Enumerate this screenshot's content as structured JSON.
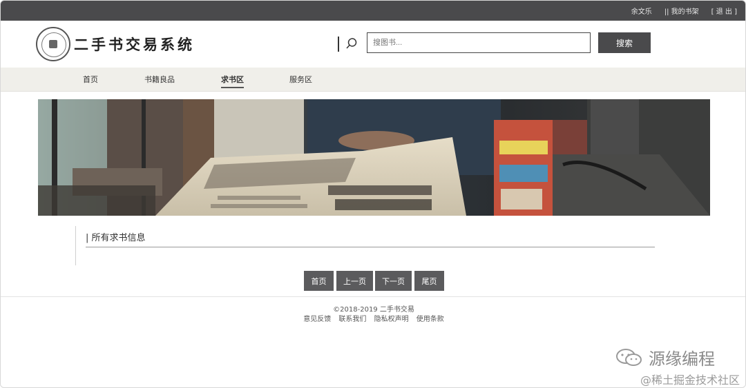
{
  "topbar": {
    "user": "余文乐",
    "bookshelf": "|| 我的书架",
    "logout": "[ 退 出 ]"
  },
  "header": {
    "logo_title": "二手书交易系统",
    "search_placeholder": "搜图书...",
    "search_button": "搜索"
  },
  "nav": {
    "items": [
      {
        "label": "首页"
      },
      {
        "label": "书籍良品"
      },
      {
        "label": "求书区"
      },
      {
        "label": "服务区"
      }
    ],
    "active": "求书区"
  },
  "section": {
    "title": "| 所有求书信息"
  },
  "pager": {
    "first": "首页",
    "prev": "上一页",
    "next": "下一页",
    "last": "尾页"
  },
  "footer": {
    "copyright": "©2018-2019 二手书交易",
    "links": [
      "意见反馈",
      "联系我们",
      "隐私权声明",
      "使用条款"
    ]
  },
  "watermarks": {
    "wechat": "源缘编程",
    "juejin": "@稀土掘金技术社区"
  },
  "colors": {
    "topbar": "#4a4a4c",
    "nav_bg": "#f0efea",
    "button": "#5b5b5d"
  }
}
